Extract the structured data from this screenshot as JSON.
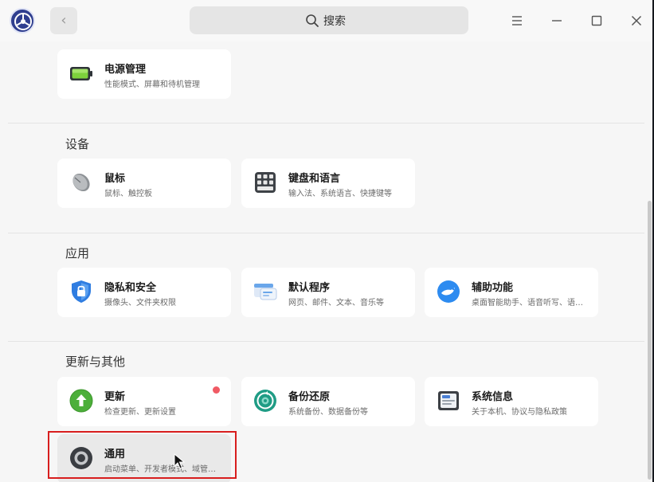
{
  "header": {
    "back_symbol": "‹",
    "search_placeholder": "搜索"
  },
  "power_card": {
    "title": "电源管理",
    "desc": "性能模式、屏幕和待机管理",
    "icon": "battery-icon"
  },
  "sections": {
    "devices": {
      "title": "设备",
      "mouse": {
        "title": "鼠标",
        "desc": "鼠标、触控板",
        "icon": "mouse-icon"
      },
      "keyboard": {
        "title": "键盘和语言",
        "desc": "输入法、系统语言、快捷键等",
        "icon": "keyboard-icon"
      }
    },
    "apps": {
      "title": "应用",
      "privacy": {
        "title": "隐私和安全",
        "desc": "摄像头、文件夹权限",
        "icon": "shield-icon"
      },
      "default_apps": {
        "title": "默认程序",
        "desc": "网页、邮件、文本、音乐等",
        "icon": "default-apps-icon"
      },
      "accessibility": {
        "title": "辅助功能",
        "desc": "桌面智能助手、语音听写、语…",
        "icon": "accessibility-icon"
      }
    },
    "updates_other": {
      "title": "更新与其他",
      "update": {
        "title": "更新",
        "desc": "检查更新、更新设置",
        "icon": "update-arrow-icon"
      },
      "backup": {
        "title": "备份还原",
        "desc": "系统备份、数据备份等",
        "icon": "backup-icon"
      },
      "system_info": {
        "title": "系统信息",
        "desc": "关于本机、协议与隐私政策",
        "icon": "system-info-icon"
      },
      "general": {
        "title": "通用",
        "desc": "启动菜单、开发者模式、域管…",
        "icon": "general-icon"
      }
    }
  },
  "colors": {
    "accent_red": "#d81e1e",
    "notification_dot": "#f05a64",
    "background": "#f6f6f6",
    "card": "#ffffff"
  }
}
